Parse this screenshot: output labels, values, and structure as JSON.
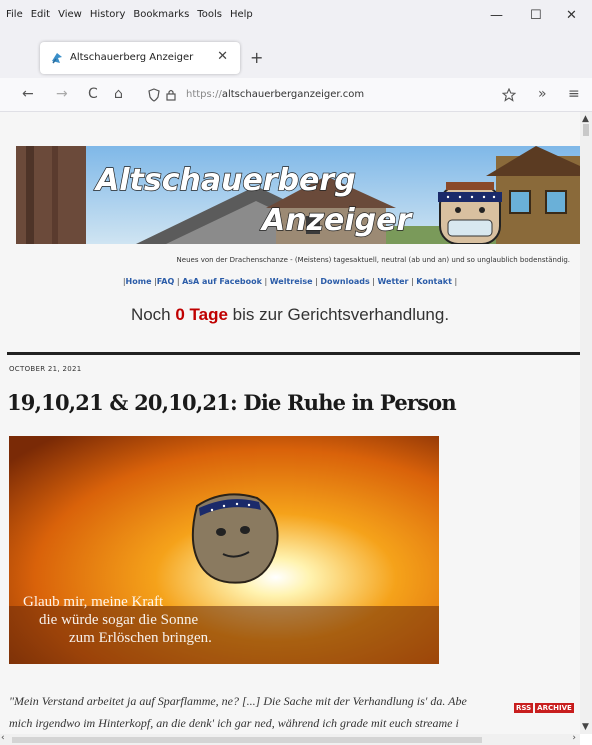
{
  "menu": [
    "File",
    "Edit",
    "View",
    "History",
    "Bookmarks",
    "Tools",
    "Help"
  ],
  "window_controls": {
    "minimize": "—",
    "maximize": "☐",
    "close": "✕"
  },
  "tab": {
    "title": "Altschauerberg Anzeiger",
    "close": "✕"
  },
  "new_tab": "+",
  "nav": {
    "back": "←",
    "forward": "→",
    "reload": "C",
    "home": "⌂",
    "more": "»",
    "menu": "≡"
  },
  "url": {
    "scheme": "https://",
    "host": "altschauerberganzeiger.com"
  },
  "banner": {
    "line1": "Altschauerberg",
    "line2": "Anzeiger"
  },
  "tagline": "Neues von der Drachenschanze - (Meistens) tagesaktuell, neutral (ab und an) und so unglaublich bodenständig.",
  "links": [
    "Home",
    "FAQ",
    "AsA auf Facebook",
    "Weltreise",
    "Downloads",
    "Wetter",
    "Kontakt"
  ],
  "countdown": {
    "pre": "Noch ",
    "value": "0 Tage",
    "post": " bis zur Gerichtsverhandlung."
  },
  "post": {
    "date": "OCTOBER 21, 2021",
    "title": "19,10,21 & 20,10,21: Die Ruhe in Person",
    "image_caption": [
      "Glaub mir, meine Kraft",
      "die würde sogar die Sonne",
      "zum Erlöschen bringen."
    ],
    "quote_lines": [
      "\"Mein Verstand arbeitet ja auf Sparflamme, ne? [...] Die Sache mit der Verhandlung is' da. Abe",
      "mich irgendwo im Hinterkopf, an die denk' ich gar ned, während ich grade mit euch streame i"
    ]
  },
  "feed_badges": [
    "RSS",
    "ARCHIVE"
  ],
  "colors": {
    "link": "#2b5ca8",
    "countdown_red": "#c00000",
    "rule": "#222222"
  }
}
